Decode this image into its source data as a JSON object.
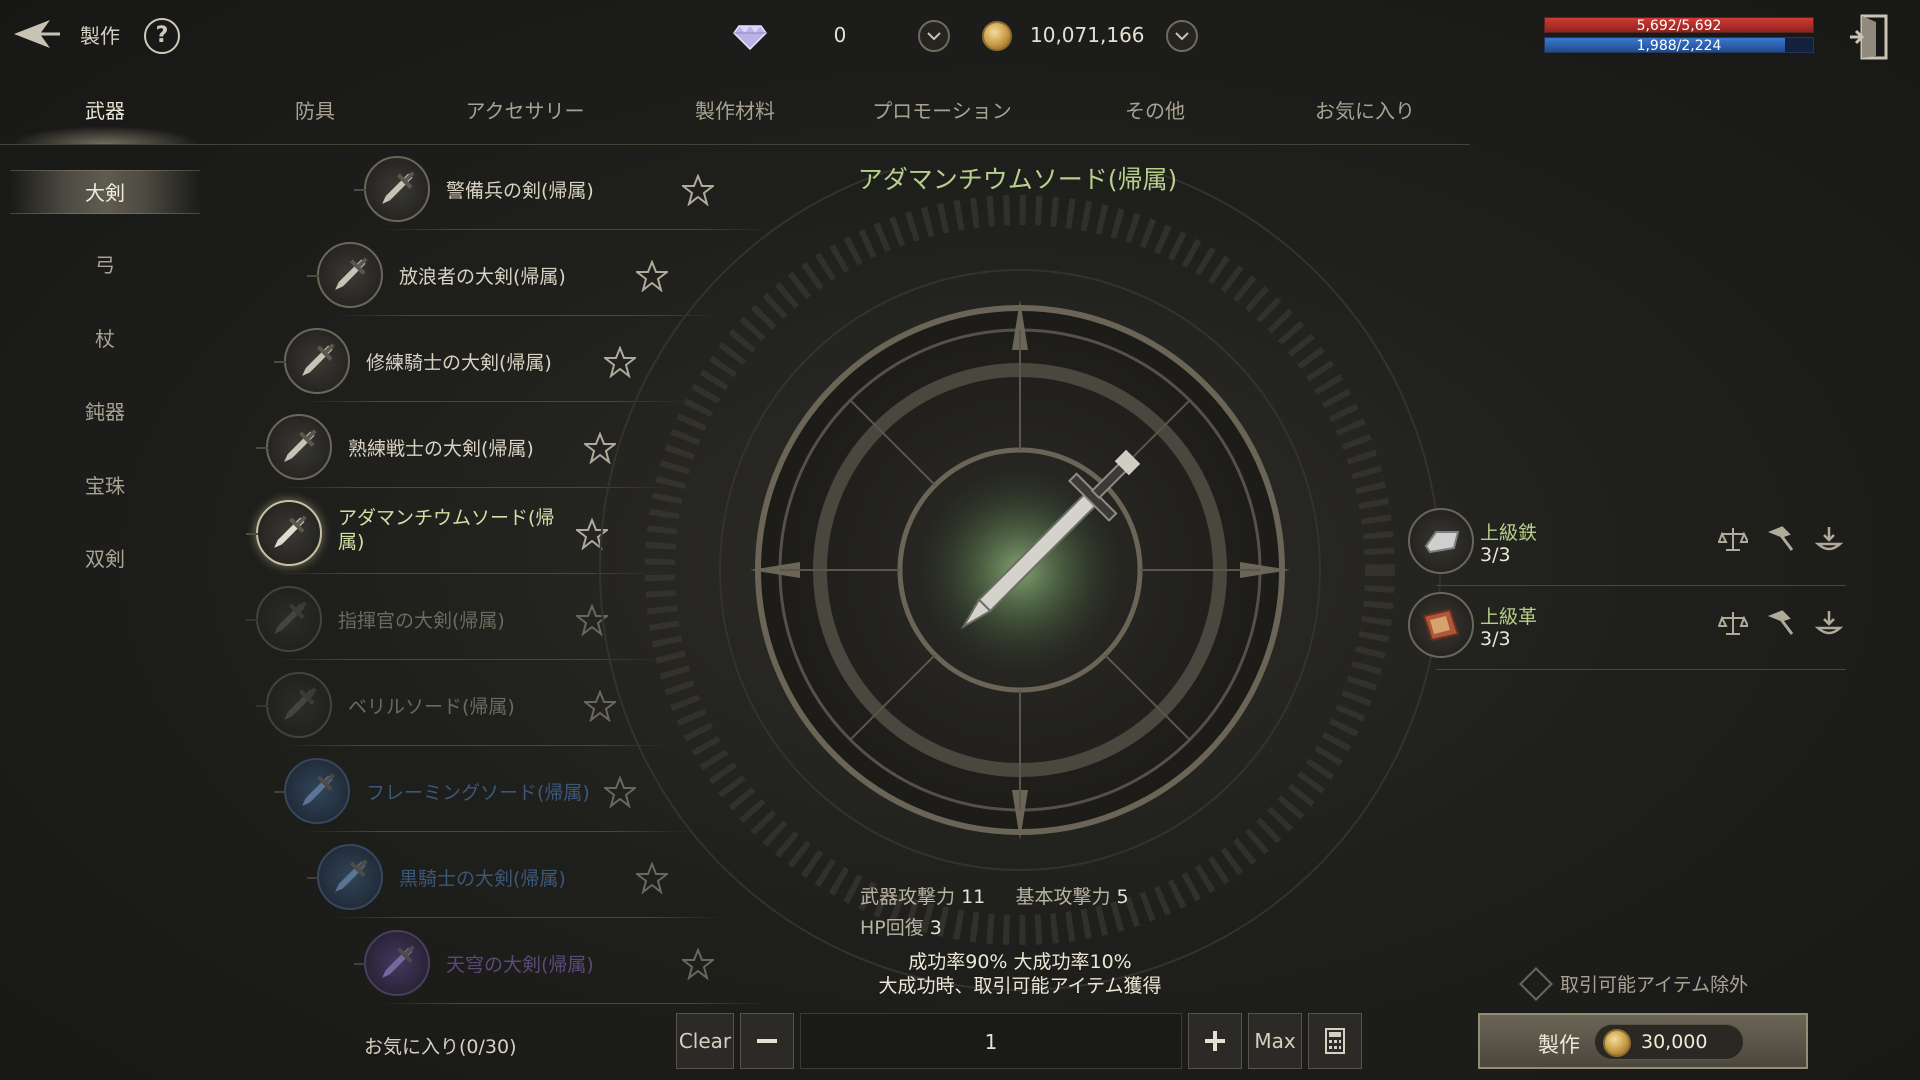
{
  "header": {
    "title": "製作",
    "help_label": "?",
    "gem_value": "0",
    "gold_value": "10,071,166",
    "hp_text": "5,692/5,692",
    "mp_text": "1,988/2,224",
    "hp_fraction": 1.0,
    "mp_fraction": 0.894
  },
  "tabs": [
    "武器",
    "防具",
    "アクセサリー",
    "製作材料",
    "プロモーション",
    "その他",
    "お気に入り"
  ],
  "subcategories": [
    "大剣",
    "弓",
    "杖",
    "鈍器",
    "宝珠",
    "双剣"
  ],
  "items": [
    {
      "name": "警備兵の剣(帰属)",
      "state": "normal"
    },
    {
      "name": "放浪者の大剣(帰属)",
      "state": "normal"
    },
    {
      "name": "修練騎士の大剣(帰属)",
      "state": "normal"
    },
    {
      "name": "熟練戦士の大剣(帰属)",
      "state": "normal"
    },
    {
      "name": "アダマンチウムソード(帰属)",
      "state": "selected"
    },
    {
      "name": "指揮官の大剣(帰属)",
      "state": "dim"
    },
    {
      "name": "ベリルソード(帰属)",
      "state": "dim"
    },
    {
      "name": "フレーミングソード(帰属)",
      "state": "blue"
    },
    {
      "name": "黒騎士の大剣(帰属)",
      "state": "blue"
    },
    {
      "name": "天穹の大剣(帰属)",
      "state": "purple"
    }
  ],
  "favorites_label": "お気に入り(0/30)",
  "selected_item": {
    "title": "アダマンチウムソード(帰属)",
    "weapon_attack_label": "武器攻撃力",
    "weapon_attack_value": "11",
    "base_attack_label": "基本攻撃力",
    "base_attack_value": "5",
    "hp_regen_label": "HP回復",
    "hp_regen_value": "3",
    "rate_line": "成功率90%  大成功率10%",
    "great_success_line": "大成功時、取引可能アイテム獲得"
  },
  "materials": [
    {
      "name": "上級鉄",
      "count": "3/3",
      "icon": "iron-icon"
    },
    {
      "name": "上級革",
      "count": "3/3",
      "icon": "leather-icon"
    }
  ],
  "controls": {
    "clear_label": "Clear",
    "quantity": "1",
    "max_label": "Max",
    "exclude_label": "取引可能アイテム除外",
    "craft_label": "製作",
    "craft_cost": "30,000"
  },
  "colors": {
    "accent_green": "#b7cf8a",
    "hp_red": "#b9302c",
    "mp_blue": "#2c63b5",
    "gold": "#c79b43"
  }
}
